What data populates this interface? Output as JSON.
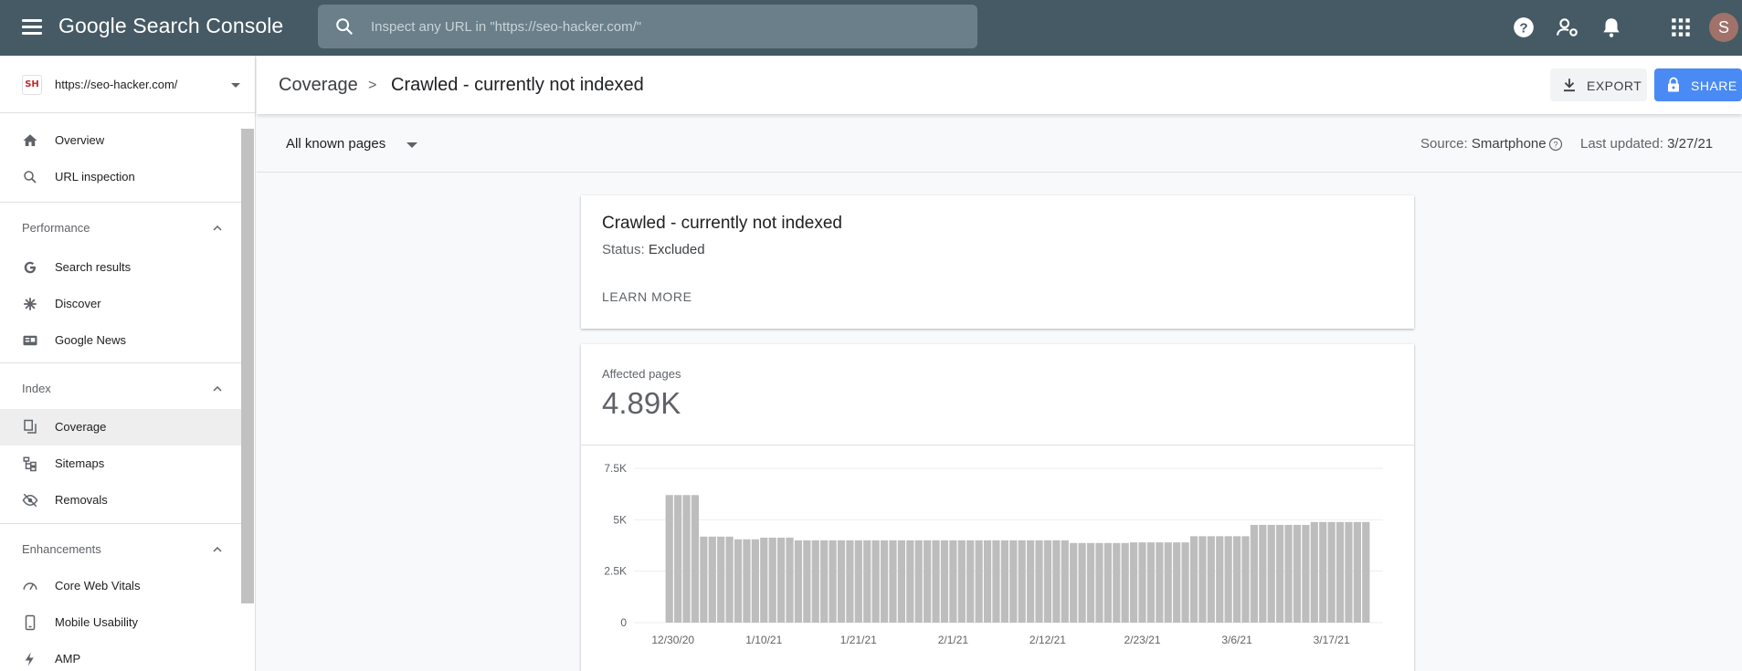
{
  "topbar": {
    "app_title": "Google Search Console",
    "search_placeholder": "Inspect any URL in \"https://seo-hacker.com/\"",
    "avatar_letter": "S",
    "bar_color": "#455a64"
  },
  "sidebar": {
    "property": "https://seo-hacker.com/",
    "top_items": [
      {
        "label": "Overview",
        "icon": "home-icon"
      },
      {
        "label": "URL inspection",
        "icon": "search-icon"
      }
    ],
    "sections": [
      {
        "title": "Performance",
        "items": [
          {
            "label": "Search results",
            "icon": "google-g-icon"
          },
          {
            "label": "Discover",
            "icon": "asterisk-icon"
          },
          {
            "label": "Google News",
            "icon": "news-icon"
          }
        ]
      },
      {
        "title": "Index",
        "items": [
          {
            "label": "Coverage",
            "icon": "coverage-icon",
            "active": true
          },
          {
            "label": "Sitemaps",
            "icon": "sitemap-icon"
          },
          {
            "label": "Removals",
            "icon": "eye-off-icon"
          }
        ]
      },
      {
        "title": "Enhancements",
        "items": [
          {
            "label": "Core Web Vitals",
            "icon": "gauge-icon"
          },
          {
            "label": "Mobile Usability",
            "icon": "phone-icon"
          },
          {
            "label": "AMP",
            "icon": "bolt-icon"
          }
        ]
      }
    ]
  },
  "header": {
    "breadcrumb_root": "Coverage",
    "breadcrumb_sep": ">",
    "breadcrumb_current": "Crawled - currently not indexed",
    "export_label": "EXPORT",
    "share_label": "SHARE",
    "accent": "#4a8af4"
  },
  "filter": {
    "selected": "All known pages",
    "source_label": "Source:",
    "source_value": "Smartphone",
    "updated_label": "Last updated:",
    "updated_value": "3/27/21"
  },
  "status_card": {
    "title": "Crawled - currently not indexed",
    "status_label": "Status:",
    "status_value": "Excluded",
    "learn_more": "LEARN MORE"
  },
  "affected_card": {
    "label": "Affected pages",
    "value": "4.89K"
  },
  "chart_data": {
    "type": "bar",
    "title": "",
    "xlabel": "",
    "ylabel": "",
    "ylim": [
      0,
      7500
    ],
    "yticks": [
      0,
      2500,
      5000,
      7500
    ],
    "ytick_labels": [
      "0",
      "2.5K",
      "5K",
      "7.5K"
    ],
    "xtick_labels": [
      "12/30/20",
      "1/10/21",
      "1/21/21",
      "2/1/21",
      "2/12/21",
      "2/23/21",
      "3/6/21",
      "3/17/21"
    ],
    "bar_color": "#bdbdbd",
    "values": [
      6200,
      6200,
      6200,
      6200,
      4180,
      4180,
      4180,
      4180,
      4050,
      4050,
      4050,
      4130,
      4130,
      4130,
      4130,
      4000,
      4000,
      4000,
      4000,
      4000,
      4000,
      4000,
      4000,
      4000,
      4000,
      4000,
      4000,
      4000,
      4000,
      4000,
      4000,
      4000,
      4000,
      4000,
      4000,
      4000,
      4000,
      4000,
      4000,
      4000,
      4000,
      4000,
      4000,
      4000,
      4000,
      4000,
      4000,
      3870,
      3870,
      3870,
      3870,
      3870,
      3870,
      3870,
      3900,
      3900,
      3900,
      3900,
      3900,
      3900,
      3900,
      4200,
      4200,
      4200,
      4200,
      4200,
      4200,
      4200,
      4750,
      4750,
      4750,
      4750,
      4750,
      4750,
      4750,
      4890,
      4890,
      4890,
      4890,
      4890,
      4890,
      4890
    ],
    "xtick_bar_index": [
      0,
      11,
      22,
      33,
      44,
      55,
      66,
      77
    ]
  }
}
